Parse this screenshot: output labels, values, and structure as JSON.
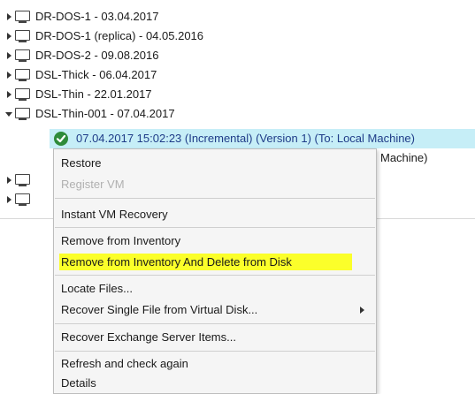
{
  "tree": {
    "items": [
      {
        "label": "DR-DOS-1 - 03.04.2017",
        "state": "collapsed"
      },
      {
        "label": "DR-DOS-1 (replica) - 04.05.2016",
        "state": "collapsed"
      },
      {
        "label": "DR-DOS-2 - 09.08.2016",
        "state": "collapsed"
      },
      {
        "label": "DSL-Thick - 06.04.2017",
        "state": "collapsed"
      },
      {
        "label": "DSL-Thin - 22.01.2017",
        "state": "collapsed"
      },
      {
        "label": "DSL-Thin-001 - 07.04.2017",
        "state": "expanded"
      }
    ],
    "selected_restore_point": "07.04.2017 15:02:23 (Incremental) (Version 1) (To: Local Machine)",
    "partial_row_text": "Machine)"
  },
  "context_menu": {
    "items": [
      {
        "label": "Restore",
        "enabled": true
      },
      {
        "label": "Register VM",
        "enabled": false
      },
      {
        "label": "Instant VM Recovery",
        "enabled": true
      },
      {
        "label": "Remove from Inventory",
        "enabled": true
      },
      {
        "label": "Remove from Inventory And Delete from Disk",
        "enabled": true,
        "highlighted": true
      },
      {
        "label": "Locate Files...",
        "enabled": true
      },
      {
        "label": "Recover Single File from Virtual Disk...",
        "enabled": true,
        "submenu": true
      },
      {
        "label": "Recover Exchange Server Items...",
        "enabled": true
      },
      {
        "label": "Refresh and check again",
        "enabled": true
      },
      {
        "label": "Details",
        "enabled": true
      }
    ]
  },
  "colors": {
    "selection_bg": "#c6eef7",
    "selection_text": "#1f3c88",
    "highlight": "#fbff2a",
    "status_ok": "#2e8b3a",
    "menu_bg": "#f5f5f5"
  },
  "icons": {
    "vm": "monitor-icon",
    "restore_point": "check-circle-icon",
    "expander_collapsed": "triangle-right-icon",
    "expander_expanded": "triangle-down-icon",
    "submenu": "chevron-right-icon"
  }
}
